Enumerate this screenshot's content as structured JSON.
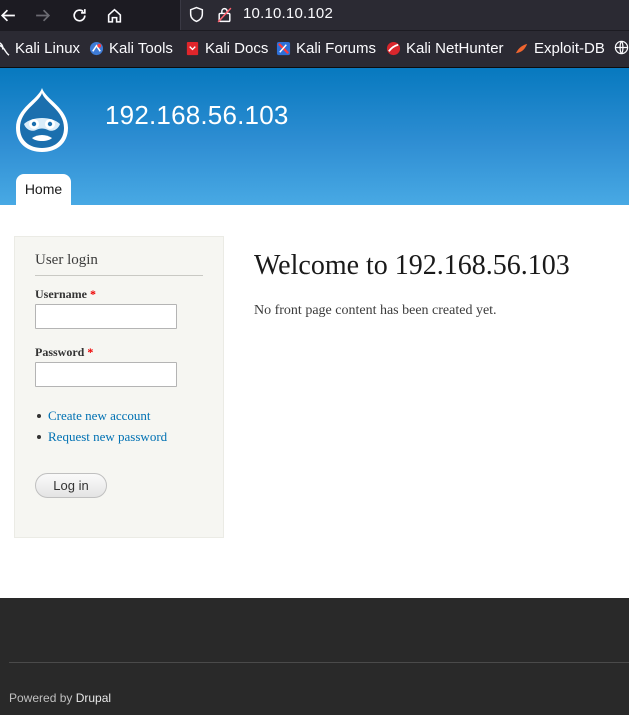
{
  "browser": {
    "url": "10.10.10.102",
    "bookmarks": [
      {
        "label": "Kali Linux",
        "icon": "kali-dragon-icon"
      },
      {
        "label": "Kali Tools",
        "icon": "kali-tools-icon"
      },
      {
        "label": "Kali Docs",
        "icon": "kali-docs-icon"
      },
      {
        "label": "Kali Forums",
        "icon": "kali-forums-icon"
      },
      {
        "label": "Kali NetHunter",
        "icon": "kali-nethunter-icon"
      },
      {
        "label": "Exploit-DB",
        "icon": "exploit-db-icon"
      }
    ]
  },
  "header": {
    "site_name": "192.168.56.103",
    "tab_home": "Home",
    "colors": {
      "top": "#0779bf",
      "bottom": "#48a9e4"
    }
  },
  "login": {
    "title": "User login",
    "username_label": "Username",
    "password_label": "Password",
    "required_marker": "*",
    "create_account": "Create new account",
    "request_password": "Request new password",
    "submit": "Log in"
  },
  "main": {
    "title": "Welcome to 192.168.56.103",
    "body": "No front page content has been created yet."
  },
  "footer": {
    "powered_by": "Powered by",
    "drupal": "Drupal"
  }
}
